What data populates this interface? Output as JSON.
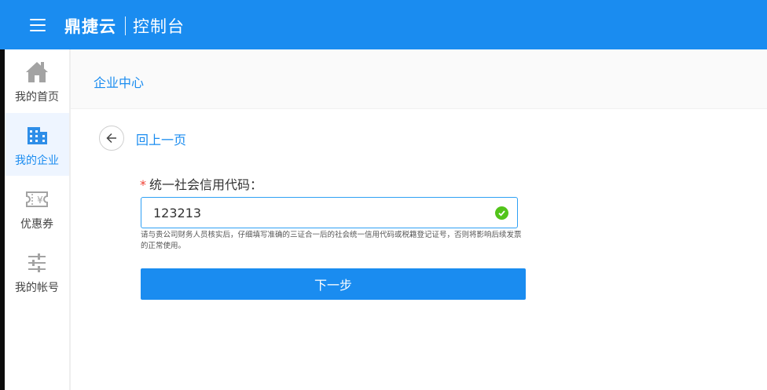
{
  "header": {
    "brand": "鼎捷云",
    "subtitle": "控制台"
  },
  "sidebar": {
    "items": [
      {
        "label": "我的首页",
        "icon": "home-icon",
        "active": false
      },
      {
        "label": "我的企业",
        "icon": "building-icon",
        "active": true
      },
      {
        "label": "优惠券",
        "icon": "coupon-icon",
        "active": false
      },
      {
        "label": "我的帐号",
        "icon": "sliders-icon",
        "active": false
      }
    ]
  },
  "page": {
    "title": "企业中心",
    "back_label": "回上一页"
  },
  "form": {
    "required_mark": "*",
    "label": "统一社会信用代码：",
    "value": "123213",
    "hint": "请与贵公司财务人员核实后，仔细填写准确的三证合一后的社会统一信用代码或税籍登记证号，否则将影响后续发票的正常使用。",
    "submit_label": "下一步"
  },
  "colors": {
    "primary": "#1a8cf0",
    "success": "#52c41a",
    "required": "#f04134"
  }
}
